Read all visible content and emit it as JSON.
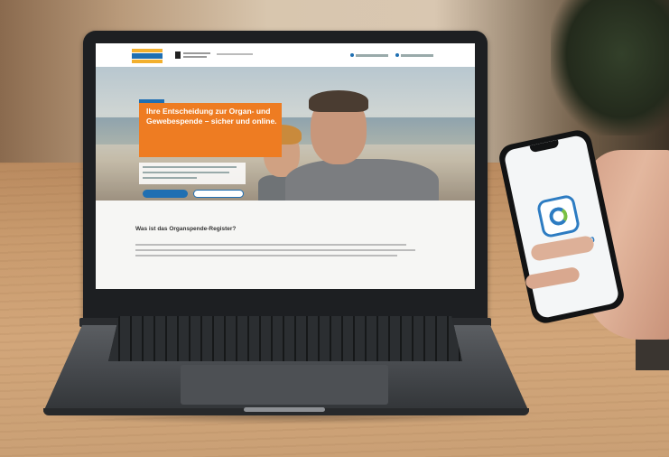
{
  "laptop_screen": {
    "hero_headline": "Ihre Entscheidung zur Organ- und Gewebespende – sicher und online.",
    "section_title": "Was ist das Organspende-Register?"
  },
  "phone_screen": {
    "app_name": "AusweisApp"
  },
  "colors": {
    "accent_orange": "#ee7c22",
    "brand_blue": "#1f6fb2",
    "app_blue": "#2d7cc2",
    "app_green": "#7ac043"
  }
}
